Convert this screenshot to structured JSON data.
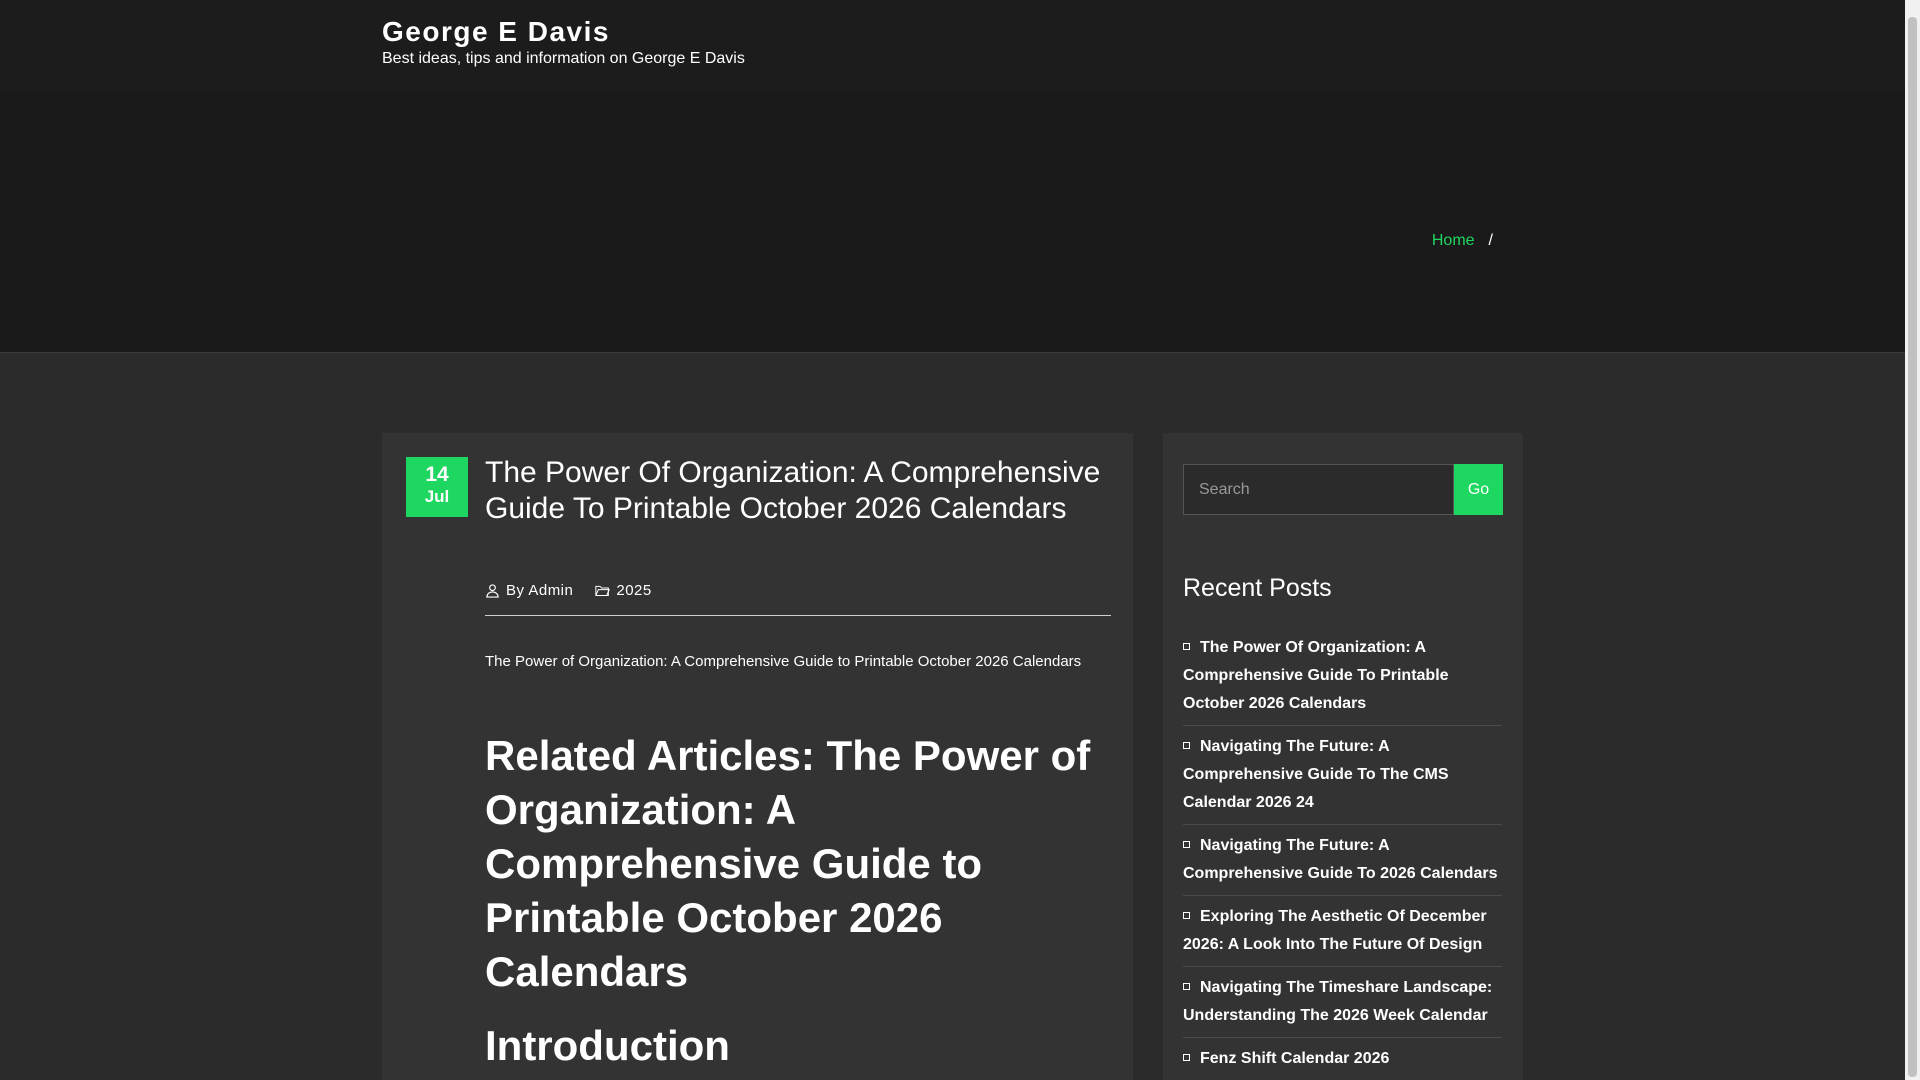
{
  "header": {
    "site_title": "George E Davis",
    "tagline": "Best ideas, tips and information on George E Davis"
  },
  "breadcrumb": {
    "home": "Home",
    "separator": "/"
  },
  "article": {
    "date_day": "14",
    "date_month": "Jul",
    "title": "The Power Of Organization: A Comprehensive Guide To Printable October 2026 Calendars",
    "author": "By Admin",
    "category": "2025",
    "intro_text": "The Power of Organization: A Comprehensive Guide to Printable October 2026 Calendars",
    "related_heading": "Related Articles: The Power of Organization: A Comprehensive Guide to Printable October 2026 Calendars",
    "intro_heading": "Introduction"
  },
  "sidebar": {
    "search_placeholder": "Search",
    "search_button": "Go",
    "recent_heading": "Recent Posts",
    "recent_posts": [
      "The Power Of Organization: A Comprehensive Guide To Printable October 2026 Calendars",
      "Navigating The Future: A Comprehensive Guide To The CMS Calendar 2026 24",
      "Navigating The Future: A Comprehensive Guide To 2026 Calendars",
      "Exploring The Aesthetic Of December 2026: A Look Into The Future Of Design",
      "Navigating The Timeshare Landscape: Understanding The 2026 Week Calendar",
      "Fenz Shift Calendar 2026"
    ]
  },
  "colors": {
    "accent": "#1ed760",
    "header_bg": "#1c1c1c",
    "page_bg": "#2b2b2b",
    "card_bg": "#333333"
  },
  "icons": {
    "author": "user-icon",
    "category": "folder-icon",
    "bullet": "square-bullet-icon"
  }
}
